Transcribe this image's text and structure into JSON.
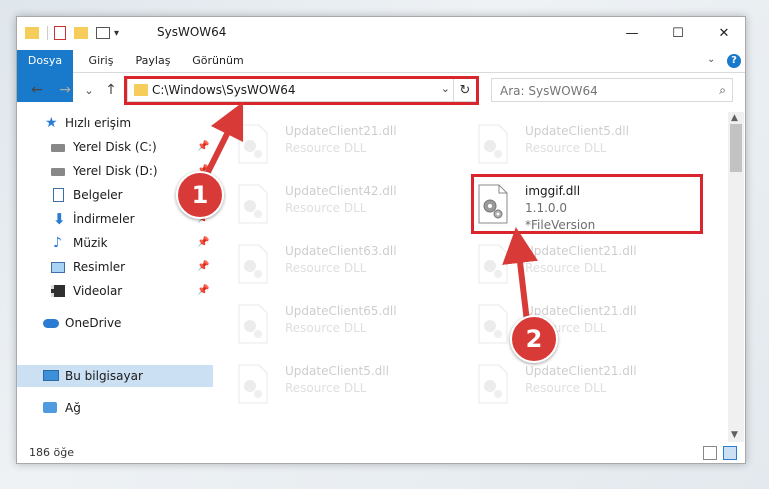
{
  "window": {
    "title": "SysWOW64",
    "controls": {
      "minimize": "—",
      "maximize": "☐",
      "close": "✕"
    }
  },
  "ribbon": {
    "tabs": [
      "Dosya",
      "Giriş",
      "Paylaş",
      "Görünüm"
    ],
    "help": "?"
  },
  "nav": {
    "back": "←",
    "forward": "→",
    "recent": "⌄",
    "up": "↑",
    "address": "C:\\Windows\\SysWOW64",
    "search_placeholder": "Ara: SysWOW64"
  },
  "sidebar": {
    "items": [
      {
        "label": "Hızlı erişim",
        "icon": "star-icon",
        "pinned": false
      },
      {
        "label": "Yerel Disk (C:)",
        "icon": "drive-icon",
        "pinned": true
      },
      {
        "label": "Yerel Disk (D:)",
        "icon": "drive-icon",
        "pinned": true
      },
      {
        "label": "Belgeler",
        "icon": "documents-icon",
        "pinned": true
      },
      {
        "label": "İndirmeler",
        "icon": "download-icon",
        "pinned": true
      },
      {
        "label": "Müzik",
        "icon": "music-icon",
        "pinned": true
      },
      {
        "label": "Resimler",
        "icon": "pictures-icon",
        "pinned": true
      },
      {
        "label": "Videolar",
        "icon": "video-icon",
        "pinned": true
      },
      {
        "label": "OneDrive",
        "icon": "cloud-icon",
        "pinned": false
      },
      {
        "label": "Bu bilgisayar",
        "icon": "computer-icon",
        "pinned": false
      },
      {
        "label": "Ağ",
        "icon": "network-icon",
        "pinned": false
      }
    ]
  },
  "files": [
    {
      "name": "UpdateClient21.dll",
      "sub": "Resource DLL",
      "faded": true
    },
    {
      "name": "UpdateClient5.dll",
      "sub": "Resource DLL",
      "faded": true
    },
    {
      "name": "UpdateClient42.dll",
      "sub": "Resource DLL",
      "faded": true
    },
    {
      "name": "imggif.dll",
      "sub": "1.1.0.0",
      "sub2": "*FileVersion",
      "faded": false
    },
    {
      "name": "UpdateClient63.dll",
      "sub": "Resource DLL",
      "faded": true
    },
    {
      "name": "UpdateClient21.dll",
      "sub": "Resource DLL",
      "faded": true
    },
    {
      "name": "UpdateClient65.dll",
      "sub": "Resource DLL",
      "faded": true
    },
    {
      "name": "UpdateClient21.dll",
      "sub": "Resource DLL",
      "faded": true
    },
    {
      "name": "UpdateClient5.dll",
      "sub": "Resource DLL",
      "faded": true
    },
    {
      "name": "UpdateClient21.dll",
      "sub": "Resource DLL",
      "faded": true
    }
  ],
  "status": {
    "count": "186 öğe"
  },
  "annotations": {
    "step1": "1",
    "step2": "2",
    "highlight_color": "#d9262c"
  }
}
